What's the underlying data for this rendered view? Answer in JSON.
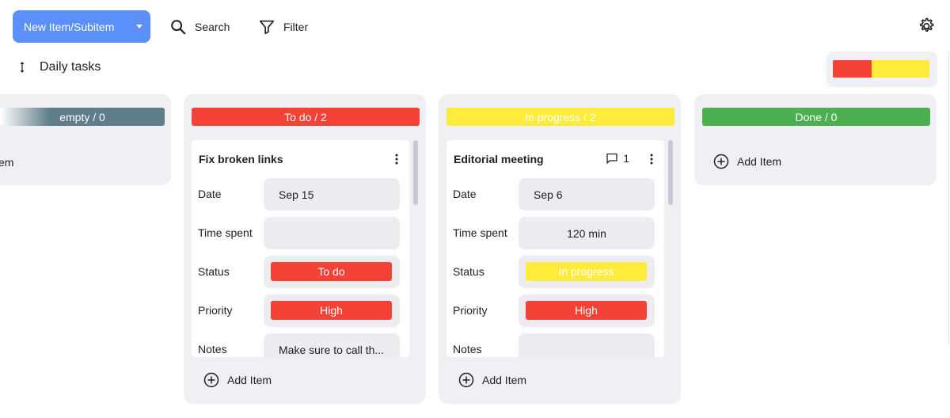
{
  "toolbar": {
    "new_item_label": "New Item/Subitem",
    "search_label": "Search",
    "filter_label": "Filter"
  },
  "board": {
    "title": "Daily tasks"
  },
  "progress": {
    "segments": [
      {
        "color": "#f44336",
        "fraction": 0.4
      },
      {
        "color": "#ffeb3b",
        "fraction": 0.6
      }
    ]
  },
  "columns": {
    "empty": {
      "header": "empty / 0",
      "color": "#607d8b",
      "partial_text": "em"
    },
    "todo": {
      "header": "To do / 2",
      "color": "#f44336",
      "card": {
        "title": "Fix broken links",
        "fields": {
          "date_label": "Date",
          "date_value": "Sep 15",
          "time_label": "Time spent",
          "time_value": "",
          "status_label": "Status",
          "status_value": "To do",
          "status_color": "#f44336",
          "priority_label": "Priority",
          "priority_value": "High",
          "priority_color": "#f44336",
          "notes_label": "Notes",
          "notes_value": "Make sure to call th..."
        }
      },
      "add_item_label": "Add Item"
    },
    "progress": {
      "header": "In progress / 2",
      "color": "#ffeb3b",
      "card": {
        "title": "Editorial meeting",
        "comment_count": "1",
        "fields": {
          "date_label": "Date",
          "date_value": "Sep 6",
          "time_label": "Time spent",
          "time_value": "120 min",
          "status_label": "Status",
          "status_value": "In progress",
          "status_color": "#ffeb3b",
          "priority_label": "Priority",
          "priority_value": "High",
          "priority_color": "#f44336",
          "notes_label": "Notes",
          "notes_value": ""
        }
      },
      "add_item_label": "Add Item"
    },
    "done": {
      "header": "Done / 0",
      "color": "#4caf50",
      "add_item_label": "Add Item"
    }
  }
}
